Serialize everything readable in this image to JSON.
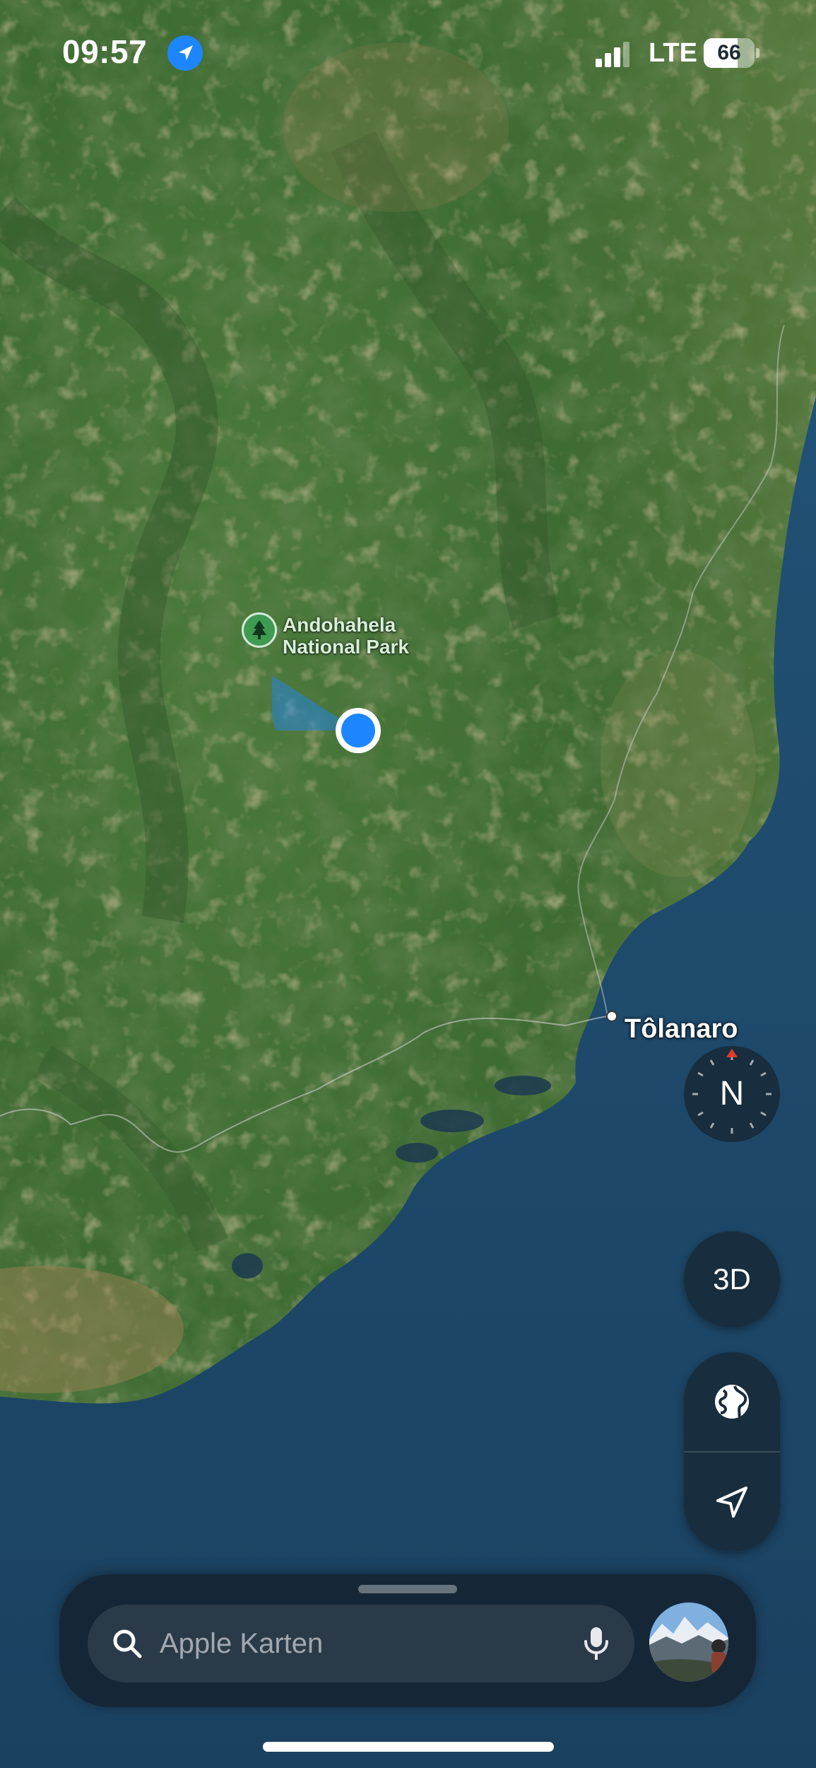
{
  "status_bar": {
    "time": "09:57",
    "network": "LTE",
    "battery_level": "66",
    "battery_fraction": 0.66,
    "location_icon": "location-arrow-icon",
    "signal_icon": "cellular-signal-icon",
    "battery_icon": "battery-icon"
  },
  "map": {
    "type": "satellite",
    "poi": {
      "name": "Andohahela National Park",
      "line1": "Andohahela",
      "line2": "National Park",
      "icon": "tree-icon"
    },
    "city": {
      "name": "Tôlanaro"
    },
    "user_location_color": "#1d86ff",
    "water_color": "#1f4a6b"
  },
  "controls": {
    "compass_letter": "N",
    "compass_needle_color": "#e23b2e",
    "mode_3d_label": "3D",
    "globe_icon": "globe-icon",
    "locate_icon": "location-arrow-outline-icon"
  },
  "search": {
    "placeholder": "Apple Karten",
    "search_icon": "magnifying-glass-icon",
    "mic_icon": "microphone-icon"
  },
  "profile": {
    "avatar_icon": "profile-avatar"
  }
}
